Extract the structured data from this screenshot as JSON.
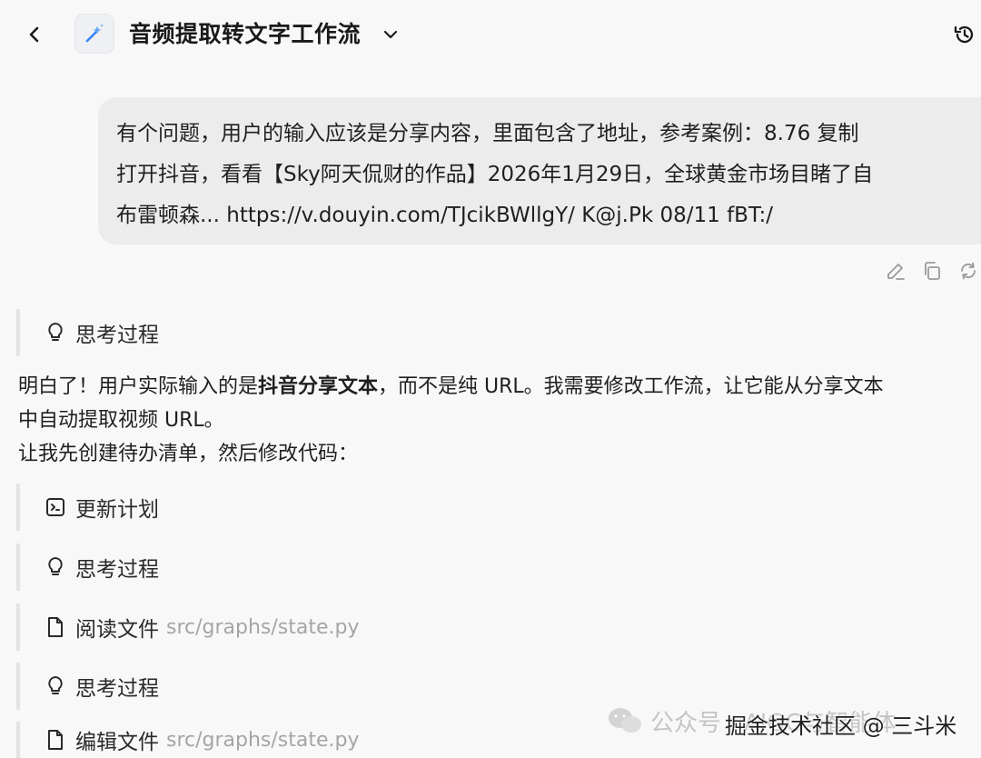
{
  "header": {
    "title": "音频提取转文字工作流",
    "back_icon": "chevron-left-icon",
    "app_icon": "wand-icon",
    "dropdown_icon": "chevron-down-icon",
    "history_icon": "history-icon"
  },
  "user_message": {
    "lines": [
      "有个问题，用户的输入应该是分享内容，里面包含了地址，参考案例：8.76 复制",
      "打开抖音，看看【Sky阿天侃财的作品】2026年1月29日，全球黄金市场目睹了自",
      "布雷顿森... https://v.douyin.com/TJcikBWllgY/ K@j.Pk 08/11 fBT:/"
    ],
    "actions": [
      "edit-icon",
      "copy-icon",
      "retry-icon"
    ]
  },
  "steps": {
    "thinking_1": {
      "label": "思考过程",
      "icon": "lightbulb-icon"
    },
    "update_plan": {
      "label": "更新计划",
      "icon": "terminal-icon"
    },
    "thinking_2": {
      "label": "思考过程",
      "icon": "lightbulb-icon"
    },
    "read_file": {
      "label": "阅读文件",
      "path": "src/graphs/state.py",
      "icon": "file-icon"
    },
    "thinking_3": {
      "label": "思考过程",
      "icon": "lightbulb-icon"
    },
    "edit_file": {
      "label": "编辑文件",
      "path": "src/graphs/state.py",
      "icon": "file-icon"
    }
  },
  "reply": {
    "line1_pre": "明白了！用户实际输入的是",
    "line1_bold": "抖音分享文本",
    "line1_post": "，而不是纯 URL。我需要修改工作流，让它能从分享文本",
    "line2": "中自动提取视频 URL。",
    "line3": "让我先创建待办清单，然后修改代码："
  },
  "watermark": {
    "text1": "公众号 · AIGC与智能体",
    "text2": "掘金技术社区 @ 三斗米"
  },
  "colors": {
    "bubble": "#ececec",
    "step_border": "#e3e3e3",
    "path_gray": "#a5a5a5"
  }
}
